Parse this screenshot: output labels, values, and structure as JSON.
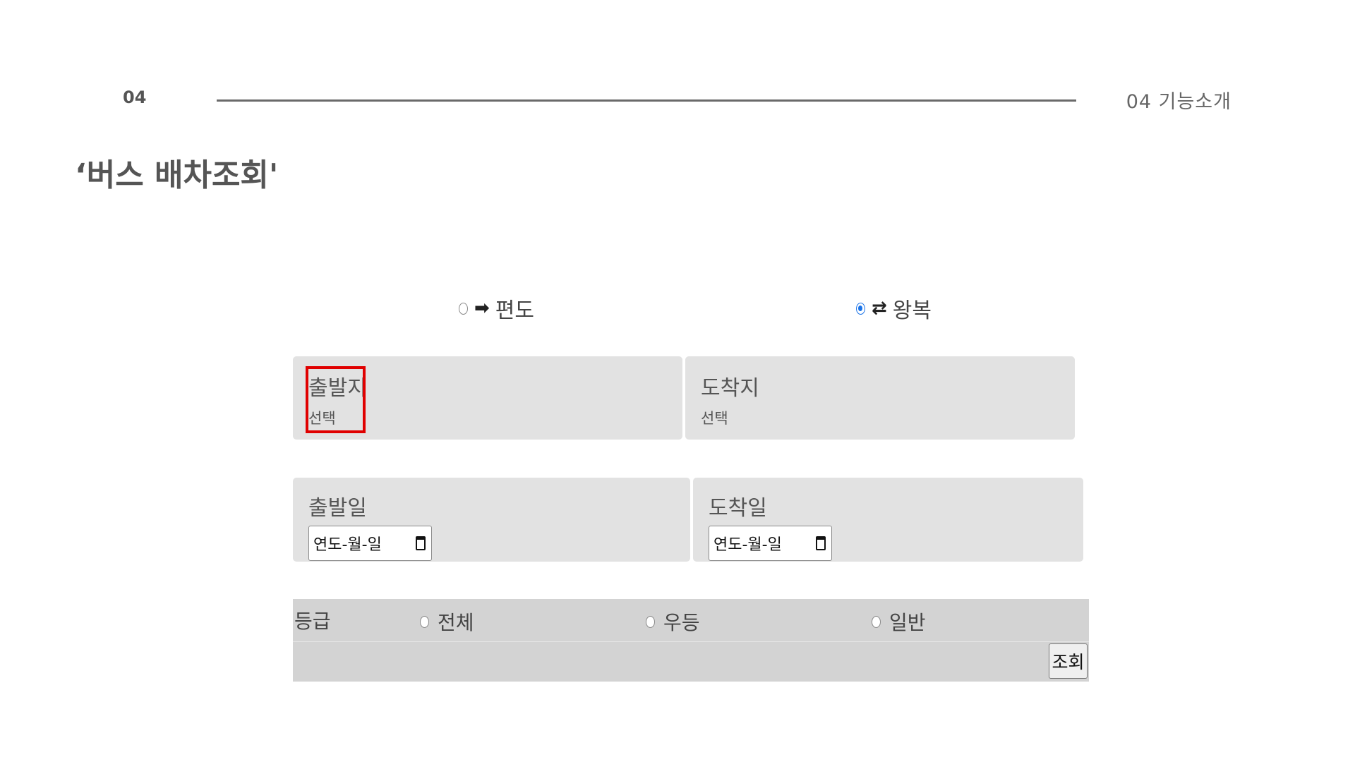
{
  "header": {
    "page_number": "04",
    "section_label": "04 기능소개"
  },
  "slide_title": "‘버스 배차조회'",
  "trip_type": {
    "oneway": {
      "arrow": "➡",
      "label": "편도",
      "checked": false
    },
    "roundtrip": {
      "arrow": "⇄",
      "label": "왕복",
      "checked": true
    }
  },
  "locations": {
    "departure": {
      "title": "출발지",
      "value": "선택"
    },
    "arrival": {
      "title": "도착지",
      "value": "선택"
    }
  },
  "dates": {
    "departure": {
      "title": "출발일",
      "placeholder": "연도-월-일"
    },
    "arrival": {
      "title": "도착일",
      "placeholder": "연도-월-일"
    }
  },
  "grade": {
    "label": "등급",
    "options": [
      {
        "label": "전체",
        "checked": false
      },
      {
        "label": "우등",
        "checked": false
      },
      {
        "label": "일반",
        "checked": false
      }
    ]
  },
  "search_button_label": "조회",
  "colors": {
    "highlight": "#e00000",
    "radio_checked": "#1a73e8",
    "panel_bg": "#e2e2e2",
    "grade_bg": "#d3d3d3"
  }
}
